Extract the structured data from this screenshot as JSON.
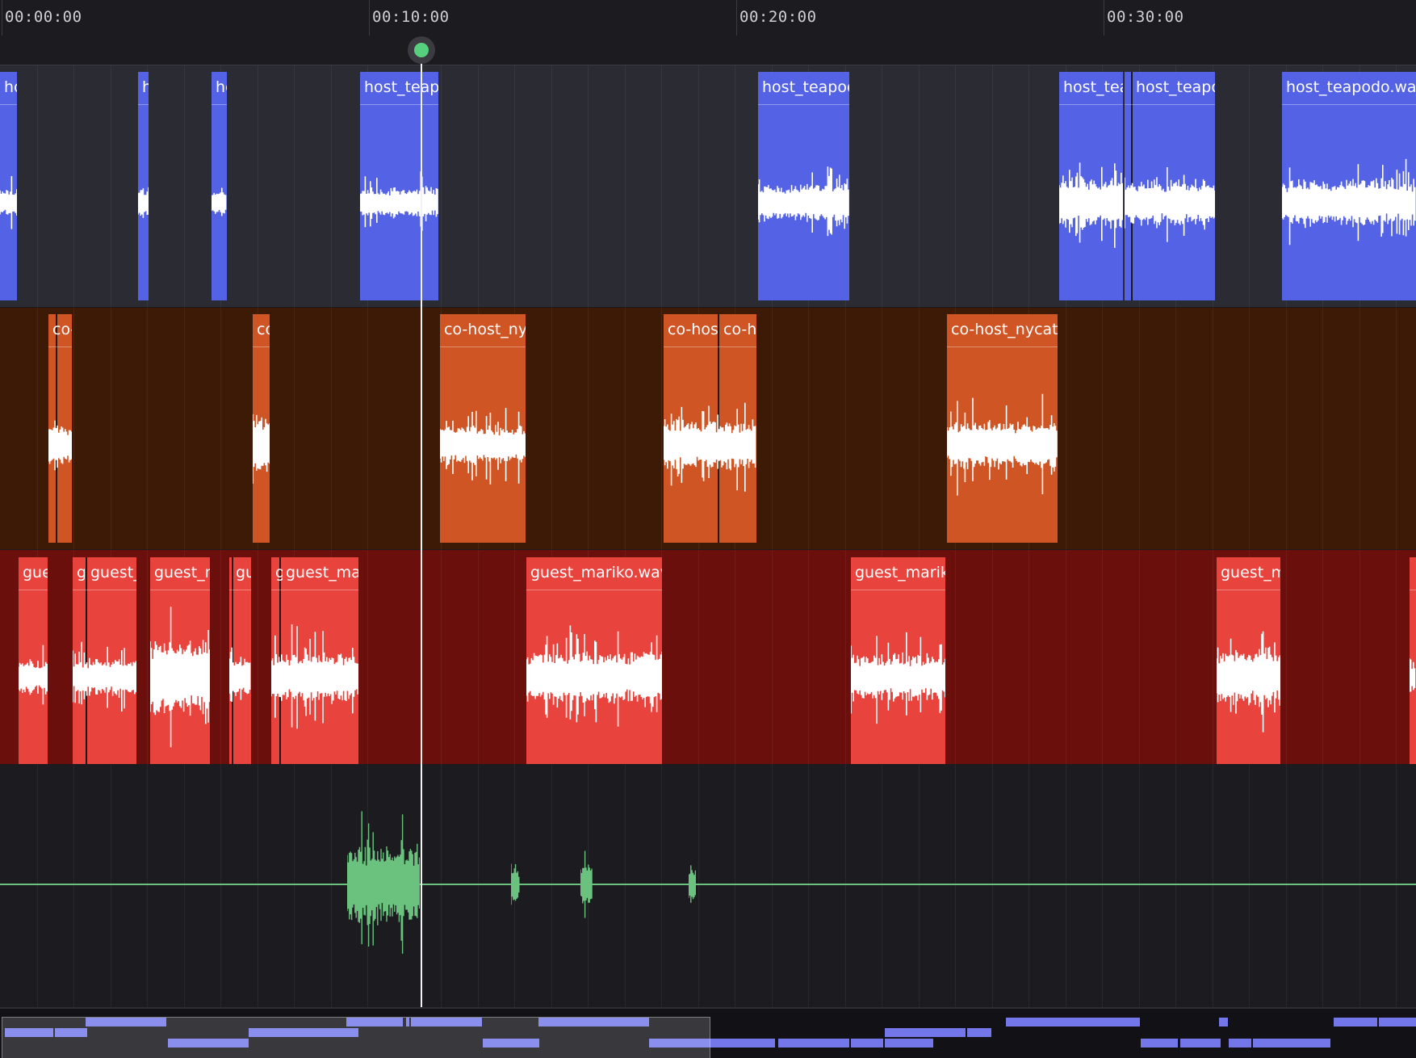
{
  "ruler": {
    "labels": [
      "00:00:00",
      "00:10:00",
      "00:20:00",
      "00:30:00"
    ]
  },
  "tracks": {
    "host": {
      "clip_label": "host_teapodo.wav",
      "color": "#5462e6"
    },
    "cohost": {
      "clip_label": "co-host_nycat.wav",
      "color": "#cf5525"
    },
    "guest": {
      "clip_label": "guest_mariko.wav",
      "color": "#e8433d"
    },
    "master": {
      "waveform_color": "#6bc27f"
    }
  },
  "colors": {
    "playhead": "#57d07e",
    "overview_bar": "#7377ea"
  }
}
